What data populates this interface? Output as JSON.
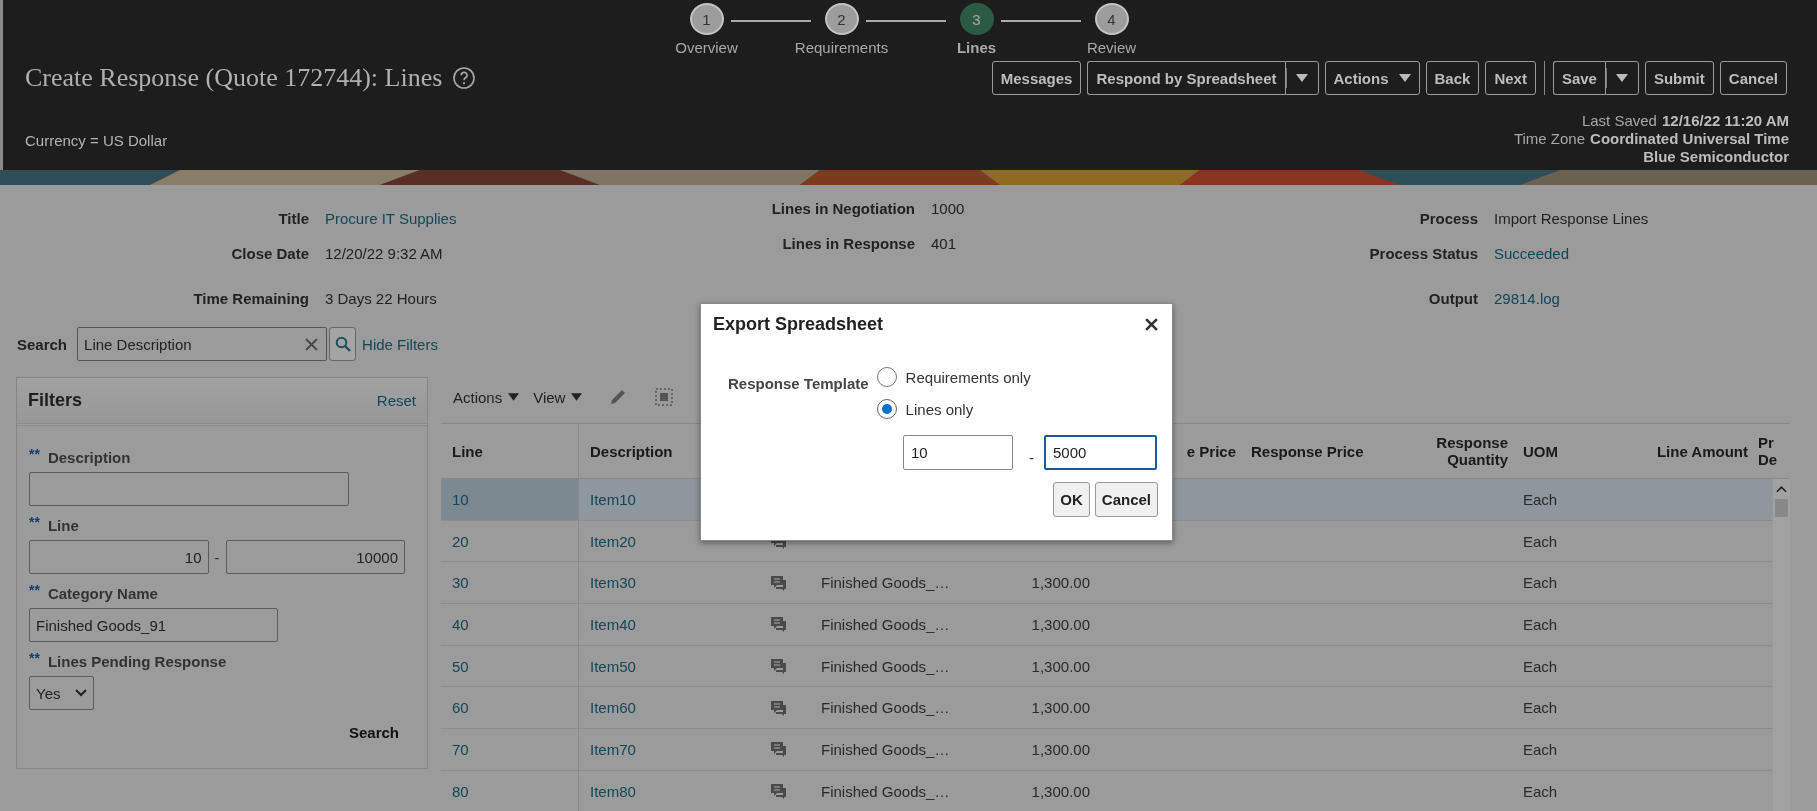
{
  "stepper": [
    {
      "number": "1",
      "label": "Overview",
      "selected": false
    },
    {
      "number": "2",
      "label": "Requirements",
      "selected": false
    },
    {
      "number": "3",
      "label": "Lines",
      "selected": true
    },
    {
      "number": "4",
      "label": "Review",
      "selected": false
    }
  ],
  "page_title": "Create Response (Quote 172744): Lines",
  "header_buttons": [
    {
      "kind": "plain",
      "label": "Messages"
    },
    {
      "kind": "split",
      "label": "Respond by Spreadsheet"
    },
    {
      "kind": "menu",
      "label": "Actions"
    },
    {
      "kind": "plain",
      "label": "Back"
    },
    {
      "kind": "plain",
      "label": "Next"
    },
    {
      "kind": "separator"
    },
    {
      "kind": "split",
      "label": "Save"
    },
    {
      "kind": "plain",
      "label": "Submit"
    },
    {
      "kind": "plain",
      "label": "Cancel"
    }
  ],
  "currency": "Currency = US Dollar",
  "save_info": [
    {
      "label": "Last Saved",
      "value": "12/16/22 11:20 AM"
    },
    {
      "label": "Time Zone",
      "value": "Coordinated Universal Time"
    },
    {
      "value": "Blue Semiconductor"
    }
  ],
  "summary": [
    [
      {
        "label": "Title",
        "value": "Procure IT Supplies",
        "kind": "link"
      },
      {
        "label": "Close Date",
        "value": "12/20/22 9:32 AM",
        "kind": "text"
      },
      {
        "label": "Time Remaining",
        "value": "3 Days 22 Hours",
        "kind": "text"
      }
    ],
    [
      {
        "label": "Lines in Negotiation",
        "value": "1000",
        "kind": "text"
      },
      {
        "label": "Lines in Response",
        "value": "401",
        "kind": "text"
      }
    ],
    [
      {
        "label": "Process",
        "value": "Import Response Lines",
        "kind": "text"
      },
      {
        "label": "Process Status",
        "value": "Succeeded",
        "kind": "link"
      },
      {
        "label": "Output",
        "value": "29814.log",
        "kind": "link"
      }
    ]
  ],
  "search": {
    "label": "Search",
    "value": "Line Description",
    "link": "Hide Filters"
  },
  "filters": {
    "title": "Filters",
    "reset": "Reset",
    "search_button": "Search",
    "fields": [
      {
        "kind": "text",
        "marker": "**",
        "label": "Description"
      },
      {
        "kind": "range",
        "marker": "**",
        "label": "Line",
        "from": "10",
        "separator": "-",
        "to": "10000"
      },
      {
        "kind": "text",
        "marker": "**",
        "label": "Category Name",
        "value": "Finished Goods_91"
      },
      {
        "kind": "select",
        "marker": "**",
        "label": "Lines Pending Response",
        "value": "Yes"
      }
    ]
  },
  "table": {
    "toolbar": [
      {
        "kind": "menu",
        "label": "Actions"
      },
      {
        "kind": "menu",
        "label": "View"
      },
      {
        "kind": "edit"
      },
      {
        "kind": "select"
      }
    ],
    "columns": [
      {
        "label": "Line"
      },
      {
        "label": "Description"
      },
      {},
      {},
      {},
      {
        "label": "e Price"
      },
      {
        "label": "Response Price"
      },
      {
        "label": "Response Quantity"
      },
      {
        "label": "UOM"
      },
      {
        "label": "Line Amount"
      },
      {
        "label": "Pr De"
      }
    ],
    "rows": [
      {
        "line": "10",
        "description": "Item10",
        "icon": false,
        "uom": "Each",
        "selected": true
      },
      {
        "line": "20",
        "description": "Item20",
        "icon": true,
        "uom": "Each",
        "selected": false
      },
      {
        "line": "30",
        "description": "Item30",
        "icon": true,
        "category": "Finished Goods_…",
        "price": "1,300.00",
        "uom": "Each",
        "selected": false
      },
      {
        "line": "40",
        "description": "Item40",
        "icon": true,
        "category": "Finished Goods_…",
        "price": "1,300.00",
        "uom": "Each",
        "selected": false
      },
      {
        "line": "50",
        "description": "Item50",
        "icon": true,
        "category": "Finished Goods_…",
        "price": "1,300.00",
        "uom": "Each",
        "selected": false
      },
      {
        "line": "60",
        "description": "Item60",
        "icon": true,
        "category": "Finished Goods_…",
        "price": "1,300.00",
        "uom": "Each",
        "selected": false
      },
      {
        "line": "70",
        "description": "Item70",
        "icon": true,
        "category": "Finished Goods_…",
        "price": "1,300.00",
        "uom": "Each",
        "selected": false
      },
      {
        "line": "80",
        "description": "Item80",
        "icon": true,
        "category": "Finished Goods_…",
        "price": "1,300.00",
        "uom": "Each",
        "selected": false
      }
    ]
  },
  "dialog": {
    "title": "Export Spreadsheet",
    "field_label": "Response Template",
    "options": [
      {
        "label": "Requirements only",
        "selected": false
      },
      {
        "label": "Lines only",
        "selected": true
      }
    ],
    "from": "10",
    "separator": "-",
    "to": "5000",
    "to_focused": true,
    "buttons": [
      "OK",
      "Cancel"
    ]
  }
}
